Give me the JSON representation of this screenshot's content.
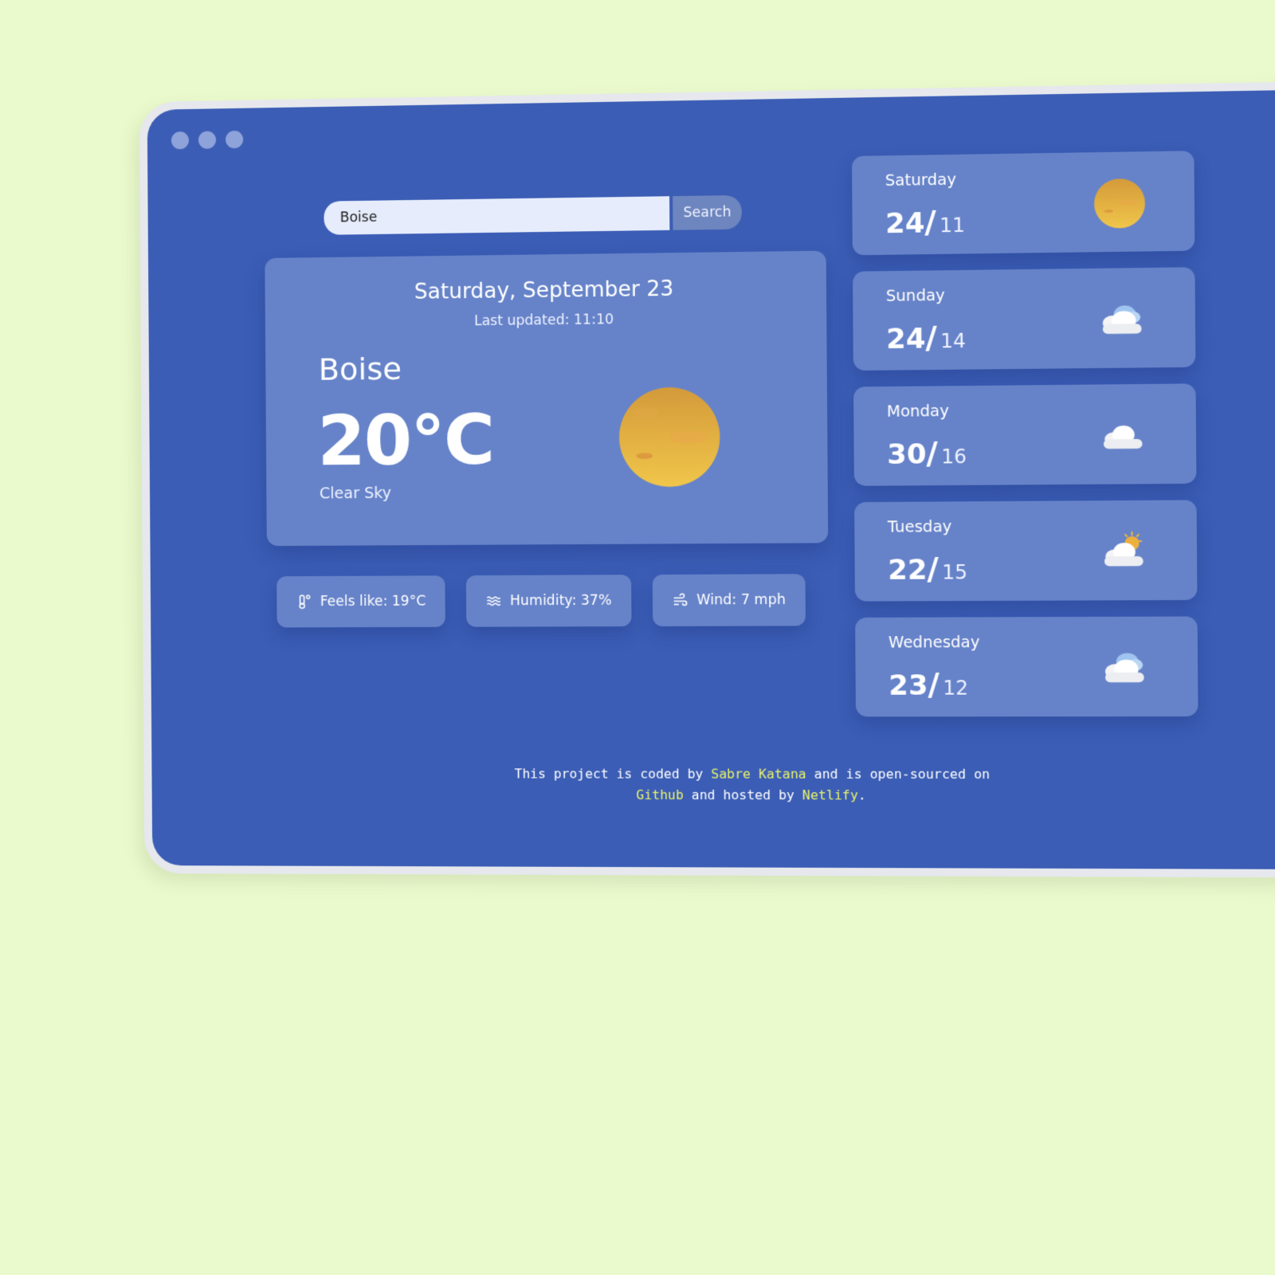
{
  "search": {
    "value": "Boise",
    "button_label": "Search"
  },
  "current": {
    "date": "Saturday, September 23",
    "last_updated": "Last updated: 11:10",
    "city": "Boise",
    "temperature": "20°C",
    "description": "Clear Sky",
    "icon": "sun-icon"
  },
  "stats": [
    {
      "label": "Feels like: 19°C",
      "icon": "thermometer-icon"
    },
    {
      "label": "Humidity: 37%",
      "icon": "humidity-icon"
    },
    {
      "label": "Wind: 7 mph",
      "icon": "wind-icon"
    }
  ],
  "forecast": [
    {
      "day": "Saturday",
      "high": "24",
      "low": "11",
      "icon": "sun-icon"
    },
    {
      "day": "Sunday",
      "high": "24",
      "low": "14",
      "icon": "cloud-icon"
    },
    {
      "day": "Monday",
      "high": "30",
      "low": "16",
      "icon": "cloud-icon"
    },
    {
      "day": "Tuesday",
      "high": "22",
      "low": "15",
      "icon": "partly-cloudy-icon"
    },
    {
      "day": "Wednesday",
      "high": "23",
      "low": "12",
      "icon": "cloud-icon"
    }
  ],
  "footer": {
    "part1": "This project is coded by ",
    "author": "Sabre Katana",
    "part2": " and is open-sourced on",
    "github": "Github",
    "part3": " and hosted by ",
    "host": "Netlify",
    "part4": "."
  },
  "colors": {
    "background": "#ebfacd",
    "window": "#3b5db5",
    "card": "#6683c9",
    "sun": "#e8b53c",
    "footer_link": "#e9f26a"
  }
}
